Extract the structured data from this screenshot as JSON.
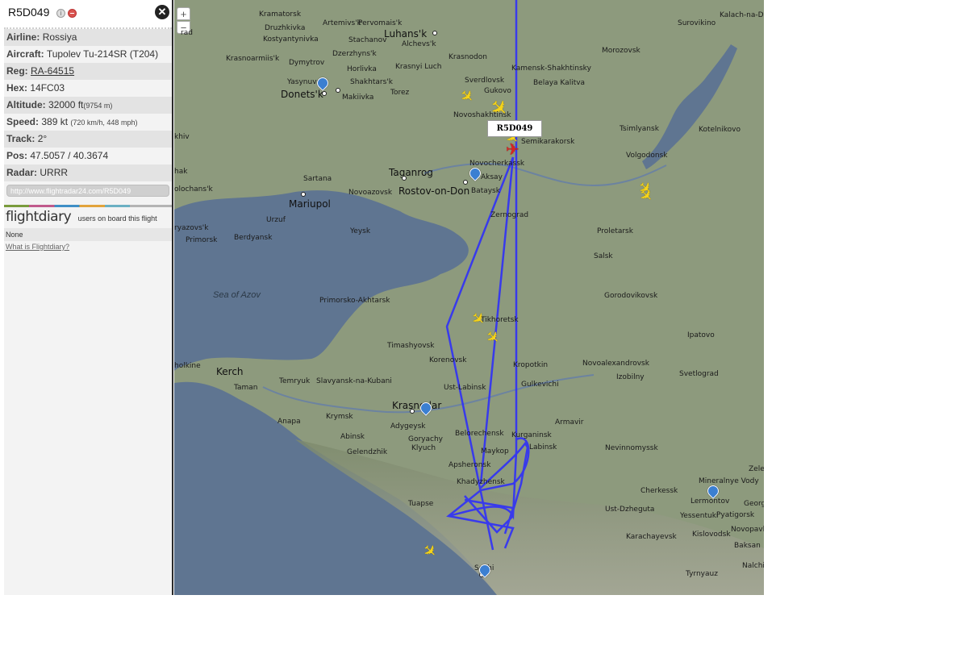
{
  "panel": {
    "callsign": "R5D049",
    "rows": {
      "airline": {
        "label": "Airline:",
        "value": "Rossiya"
      },
      "aircraft": {
        "label": "Aircraft:",
        "value": "Tupolev Tu-214SR (T204)"
      },
      "reg": {
        "label": "Reg:",
        "value": "RA-64515"
      },
      "hex": {
        "label": "Hex:",
        "value": "14FC03"
      },
      "altitude": {
        "label": "Altitude:",
        "value": "32000 ft",
        "extra": "(9754 m)"
      },
      "speed": {
        "label": "Speed:",
        "value": "389 kt",
        "extra": "(720 km/h, 448 mph)"
      },
      "track": {
        "label": "Track:",
        "value": "2°"
      },
      "pos": {
        "label": "Pos:",
        "value": "47.5057 / 40.3674"
      },
      "radar": {
        "label": "Radar:",
        "value": "URRR"
      }
    },
    "url": "http://www.flightradar24.com/R5D049",
    "flightdiary": {
      "logo": "flightdiary",
      "text": "users on board this flight",
      "none": "None",
      "link": "What is Flightdiary?"
    }
  },
  "map": {
    "zoom_in": "+",
    "zoom_out": "−",
    "flight_label": "R5D049",
    "sea": "Sea of Azov",
    "cities": {
      "kramatorsk": "Kramatorsk",
      "artemivsk": "Artemivs'k",
      "luhansk": "Luhans'k",
      "pervomaisk": "Pervomais'k",
      "druzhkivka": "Druzhkivka",
      "stachanov": "Stachanov",
      "alchevsk": "Alchevs'k",
      "kostyantynivka": "Kostyantynivka",
      "krasnoarmiisk": "Krasnoarmiis'k",
      "dymytrov": "Dymytrov",
      "dzerzhynsk": "Dzerzhyns'k",
      "krasnodon": "Krasnodon",
      "horlivka": "Horlivka",
      "krasnyi_luch": "Krasnyi Luch",
      "yasynuvata": "Yasynuvata",
      "shakhtarsk": "Shakhtars'k",
      "donetsk": "Donets'k",
      "makiivka": "Makiivka",
      "torez": "Torez",
      "sverdlovsk": "Sverdlovsk",
      "gukovo": "Gukovo",
      "novoshakhtinsk": "Novoshakhtinsk",
      "kamensk": "Kamensk-Shakhtinsky",
      "belaya_kalitva": "Belaya\nKalitva",
      "morozovsk": "Morozovsk",
      "surovikino": "Surovikino",
      "kalach": "Kalach-na-D",
      "semikarakorsk": "Semikarakorsk",
      "novocherkassk": "Novocherkassk",
      "aksay": "Aksay",
      "bataysk": "Bataysk",
      "rostov": "Rostov-on-Don",
      "taganrog": "Taganrog",
      "sartana": "Sartana",
      "novoazovsk": "Novoazovsk",
      "mariupol": "Mariupol",
      "urzuf": "Urzuf",
      "berdyansk": "Berdyansk",
      "primorsk": "Primorsk",
      "yeysk": "Yeysk",
      "zernograd": "Zernograd",
      "tsimlyansk": "Tsimlyansk",
      "volgodonsk": "Volgodonsk",
      "kotelnikovo": "Kotelnikovo",
      "proletarsk": "Proletarsk",
      "salsk": "Salsk",
      "gorodovikovsk": "Gorodovikovsk",
      "primorsko": "Primorsko-Akhtarsk",
      "tikhoretsk": "Tikhoretsk",
      "timashevsk": "Timashyovsk",
      "ipatovo": "Ipatovo",
      "korenovsk": "Korenovsk",
      "kropotkin": "Kropotkin",
      "novoaleksandrovsk": "Novoalexandrovsk",
      "izobilny": "Izobilny",
      "svetlograd": "Svetlograd",
      "kerch": "Kerch",
      "temryuk": "Temryuk",
      "slavyansk": "Slavyansk-na-Kubani",
      "taman": "Taman",
      "ust_labinsk": "Ust-Labinsk",
      "gulkevichi": "Gulkevichi",
      "krasnodar": "Krasnodar",
      "armavir": "Armavir",
      "anapa": "Anapa",
      "krymsk": "Krymsk",
      "adygeysk": "Adygeysk",
      "belorechensk": "Belorechensk",
      "kurganinsk": "Kurganinsk",
      "labinsk": "Labinsk",
      "abinsk": "Abinsk",
      "goryachy": "Goryachy",
      "klyuch": "Klyuch",
      "gelendzhik": "Gelendzhik",
      "maykop": "Maykop",
      "nevinnomyssk": "Nevinnomyssk",
      "apsheronsk": "Apsheronsk",
      "khadyzhensk": "Khadyzhensk",
      "mineralnye": "Mineralnye\nVody",
      "zele": "Zele",
      "cherkessk": "Cherkessk",
      "lermontov": "Lermontov",
      "georg": "Georg",
      "tuapse": "Tuapse",
      "ust_dzheguta": "Ust-Dzheguta",
      "yessentuki": "Yessentuki",
      "pyatigorsk": "Pyatigorsk",
      "novopavl": "Novopavlo",
      "karachayevsk": "Karachayevsk",
      "kislovodsk": "Kislovodsk",
      "baksan": "Baksan",
      "nalchik": "Nalchi",
      "tyrnyauz": "Tyrnyauz",
      "sochi": "Sochi",
      "rad": "rad",
      "khiv": "khiv",
      "hak": "hak",
      "olochansk": "olochans'k",
      "ryazovsk": "ryazovs'k",
      "holkine": "holkine"
    }
  }
}
